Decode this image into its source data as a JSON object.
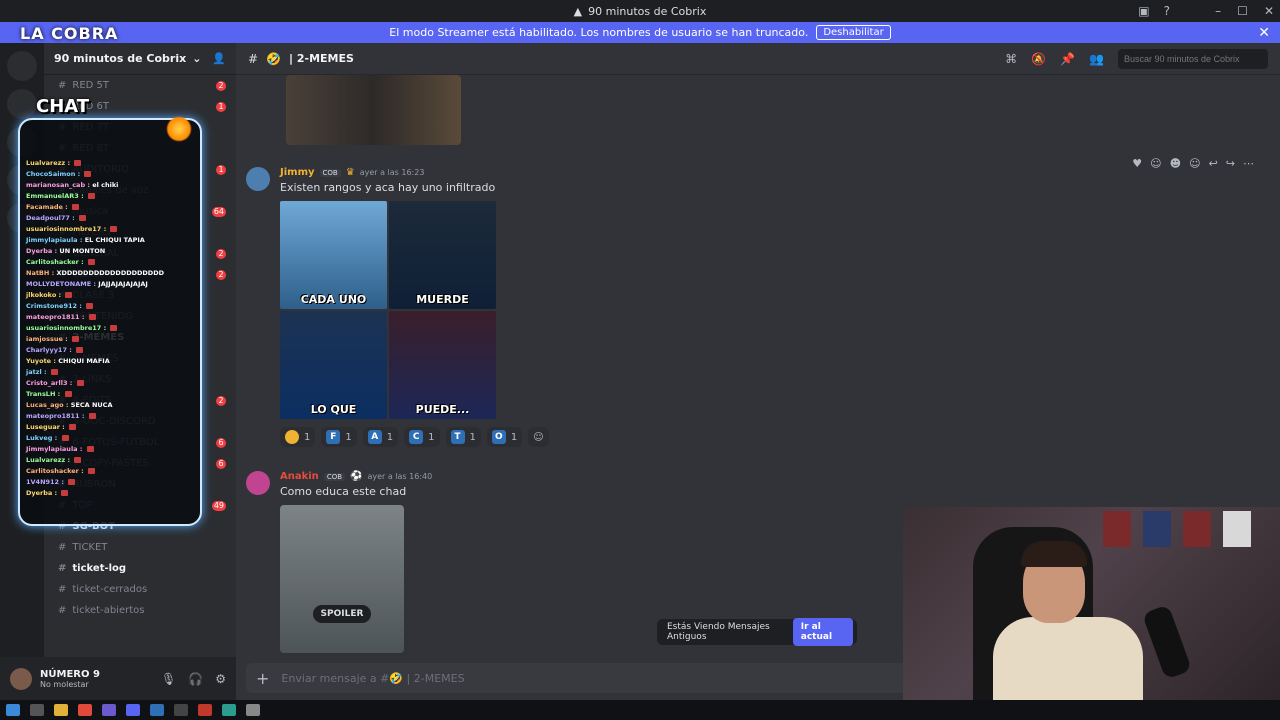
{
  "window": {
    "title": "90 minutos de Cobrix"
  },
  "banner": {
    "text": "El modo Streamer está habilitado. Los nombres de usuario se han truncado.",
    "button": "Deshabilitar"
  },
  "overlay": {
    "brand": "LA COBRA",
    "chat_label": "CHAT",
    "lines": [
      {
        "user": "Lualvarezz :",
        "msg": ""
      },
      {
        "user": "ChocoSaimon :",
        "msg": ""
      },
      {
        "user": "marianosan_cab :",
        "msg": "el chiki"
      },
      {
        "user": "EmmanuelAR3 :",
        "msg": ""
      },
      {
        "user": "Facamade :",
        "msg": ""
      },
      {
        "user": "Deadpoul77 :",
        "msg": ""
      },
      {
        "user": "usuariosinnombre17 :",
        "msg": ""
      },
      {
        "user": "Jimmylapiaula :",
        "msg": "EL CHIQUI TAPIA"
      },
      {
        "user": "Dyerba :",
        "msg": "UN MONTON"
      },
      {
        "user": "Carlitoshacker :",
        "msg": ""
      },
      {
        "user": "NatBH :",
        "msg": "XDDDDDDDDDDDDDDDDDDD"
      },
      {
        "user": "MOLLYDETONAME :",
        "msg": "JAJJAJAJAJAJAJ"
      },
      {
        "user": "jlkokoko :",
        "msg": ""
      },
      {
        "user": "Crimstone912 :",
        "msg": ""
      },
      {
        "user": "mateopro1811 :",
        "msg": ""
      },
      {
        "user": "usuariosinnombre17 :",
        "msg": ""
      },
      {
        "user": "iamjossue :",
        "msg": ""
      },
      {
        "user": "Charlyyy17 :",
        "msg": ""
      },
      {
        "user": "Yuyote :",
        "msg": "CHIQUI MAFIA"
      },
      {
        "user": "jatzl :",
        "msg": ""
      },
      {
        "user": "Cristo_arll3 :",
        "msg": ""
      },
      {
        "user": "TransLH :",
        "msg": ""
      },
      {
        "user": "Lucas_ago :",
        "msg": "SECA NUCA"
      },
      {
        "user": "mateopro1811 :",
        "msg": ""
      },
      {
        "user": "Luseguar :",
        "msg": ""
      },
      {
        "user": "Lukveg :",
        "msg": ""
      },
      {
        "user": "Jimmylapiaula :",
        "msg": ""
      },
      {
        "user": "Lualvarezz :",
        "msg": ""
      },
      {
        "user": "Carlitoshacker :",
        "msg": ""
      },
      {
        "user": "1V4N912 :",
        "msg": ""
      },
      {
        "user": "Dyerba :",
        "msg": ""
      }
    ]
  },
  "server": {
    "name": "90 minutos de Cobrix"
  },
  "channels": [
    {
      "label": "RED 5T",
      "badge": "2",
      "bold": false
    },
    {
      "label": "RED 6T",
      "badge": "1",
      "bold": false
    },
    {
      "label": "RED 7T",
      "badge": "",
      "bold": false
    },
    {
      "label": "RED 8T",
      "badge": "",
      "bold": false
    },
    {
      "label": "AUDITORIO",
      "badge": "1",
      "bold": false
    },
    {
      "label": "Canales de voz",
      "badge": "",
      "bold": false
    },
    {
      "label": "musica",
      "badge": "64",
      "bold": false
    },
    {
      "label": "FILTERS",
      "badge": "",
      "bold": false
    },
    {
      "label": "GENERAL",
      "badge": "2",
      "bold": false
    },
    {
      "label": "CLASE 1",
      "badge": "2",
      "bold": false
    },
    {
      "label": "CLASE 3",
      "badge": "",
      "bold": false
    },
    {
      "label": "CONTENIDO",
      "badge": "",
      "bold": false
    },
    {
      "label": "2-MEMES",
      "badge": "",
      "bold": true
    },
    {
      "label": "1-MEMES",
      "badge": "",
      "bold": false
    },
    {
      "label": "2-LINKS",
      "badge": "",
      "bold": false
    },
    {
      "label": "4-EDITS",
      "badge": "2",
      "bold": false
    },
    {
      "label": "5-OOC-DISCORD",
      "badge": "",
      "bold": false
    },
    {
      "label": "6-FOTOS-FUTBOL",
      "badge": "6",
      "bold": false
    },
    {
      "label": "7-COPY-PASTES",
      "badge": "6",
      "bold": false
    },
    {
      "label": "RUBRON",
      "badge": "",
      "bold": false
    },
    {
      "label": "TOP",
      "badge": "49",
      "bold": false
    },
    {
      "label": "SG-BOT",
      "badge": "",
      "bold": true
    },
    {
      "label": "TICKET",
      "badge": "",
      "bold": false
    },
    {
      "label": "ticket-log",
      "badge": "",
      "bold": true
    },
    {
      "label": "ticket-cerrados",
      "badge": "",
      "bold": false
    },
    {
      "label": "ticket-abiertos",
      "badge": "",
      "bold": false
    }
  ],
  "user": {
    "name": "NÚMERO 9",
    "status": "No molestar"
  },
  "channel_header": {
    "name": "| 2-MEMES",
    "search_placeholder": "Buscar 90 minutos de Cobrix"
  },
  "messages": [
    {
      "author": "Jimmy",
      "tag": "COB",
      "timestamp": "ayer a las 16:23",
      "text": "Existen rangos y aca hay uno infiltrado",
      "author_color": "#f0b232",
      "image_captions": [
        "CADA UNO",
        "MUERDE",
        "LO QUE",
        "PUEDE..."
      ],
      "reactions": [
        {
          "icon": "",
          "count": "1"
        },
        {
          "icon": "F",
          "count": "1"
        },
        {
          "icon": "A",
          "count": "1"
        },
        {
          "icon": "C",
          "count": "1"
        },
        {
          "icon": "T",
          "count": "1"
        },
        {
          "icon": "O",
          "count": "1"
        }
      ]
    },
    {
      "author": "Anakin",
      "tag": "COB",
      "timestamp": "ayer a las 16:40",
      "text": "Como educa este chad",
      "author_color": "#e74c3c",
      "spoiler_label": "SPOILER"
    }
  ],
  "jump_bar": {
    "text": "Estás Viendo Mensajes Antiguos",
    "button": "Ir al actual"
  },
  "composer": {
    "placeholder": "Enviar mensaje a #🤣 | 2-MEMES"
  }
}
